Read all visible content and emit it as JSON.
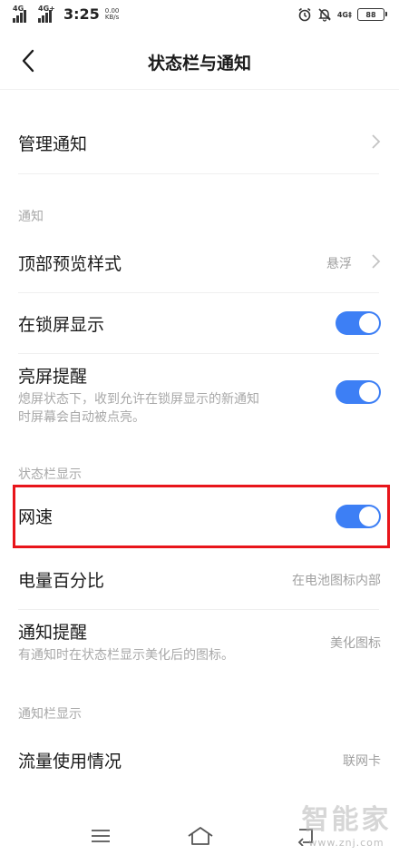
{
  "status_bar": {
    "signal_1_label": "4G",
    "signal_2_label": "4G+",
    "time": "3:25",
    "net_speed_value": "0.00",
    "net_speed_unit": "KB/s",
    "network_type": "4G‡",
    "battery": "88"
  },
  "header": {
    "title": "状态栏与通知"
  },
  "rows": {
    "manage_notifications": {
      "label": "管理通知"
    },
    "top_preview_style": {
      "label": "顶部预览样式",
      "value": "悬浮"
    },
    "show_on_lockscreen": {
      "label": "在锁屏显示",
      "on": true
    },
    "wake_screen_reminder": {
      "label": "亮屏提醒",
      "desc_line1": "熄屏状态下，收到允许在锁屏显示的新通知",
      "desc_line2": "时屏幕会自动被点亮。",
      "on": true
    },
    "network_speed": {
      "label": "网速",
      "on": true
    },
    "battery_percentage": {
      "label": "电量百分比",
      "value": "在电池图标内部"
    },
    "notification_reminder": {
      "label": "通知提醒",
      "desc": "有通知时在状态栏显示美化后的图标。",
      "value": "美化图标"
    },
    "data_usage": {
      "label": "流量使用情况",
      "value": "联网卡"
    }
  },
  "sections": {
    "notifications": "通知",
    "status_bar_display": "状态栏显示",
    "notification_bar_display": "通知栏显示"
  },
  "watermark": {
    "logo": "智能家",
    "url": "www.znj.com"
  },
  "colors": {
    "toggle_on": "#3d7ff5",
    "highlight": "#e8151b"
  }
}
